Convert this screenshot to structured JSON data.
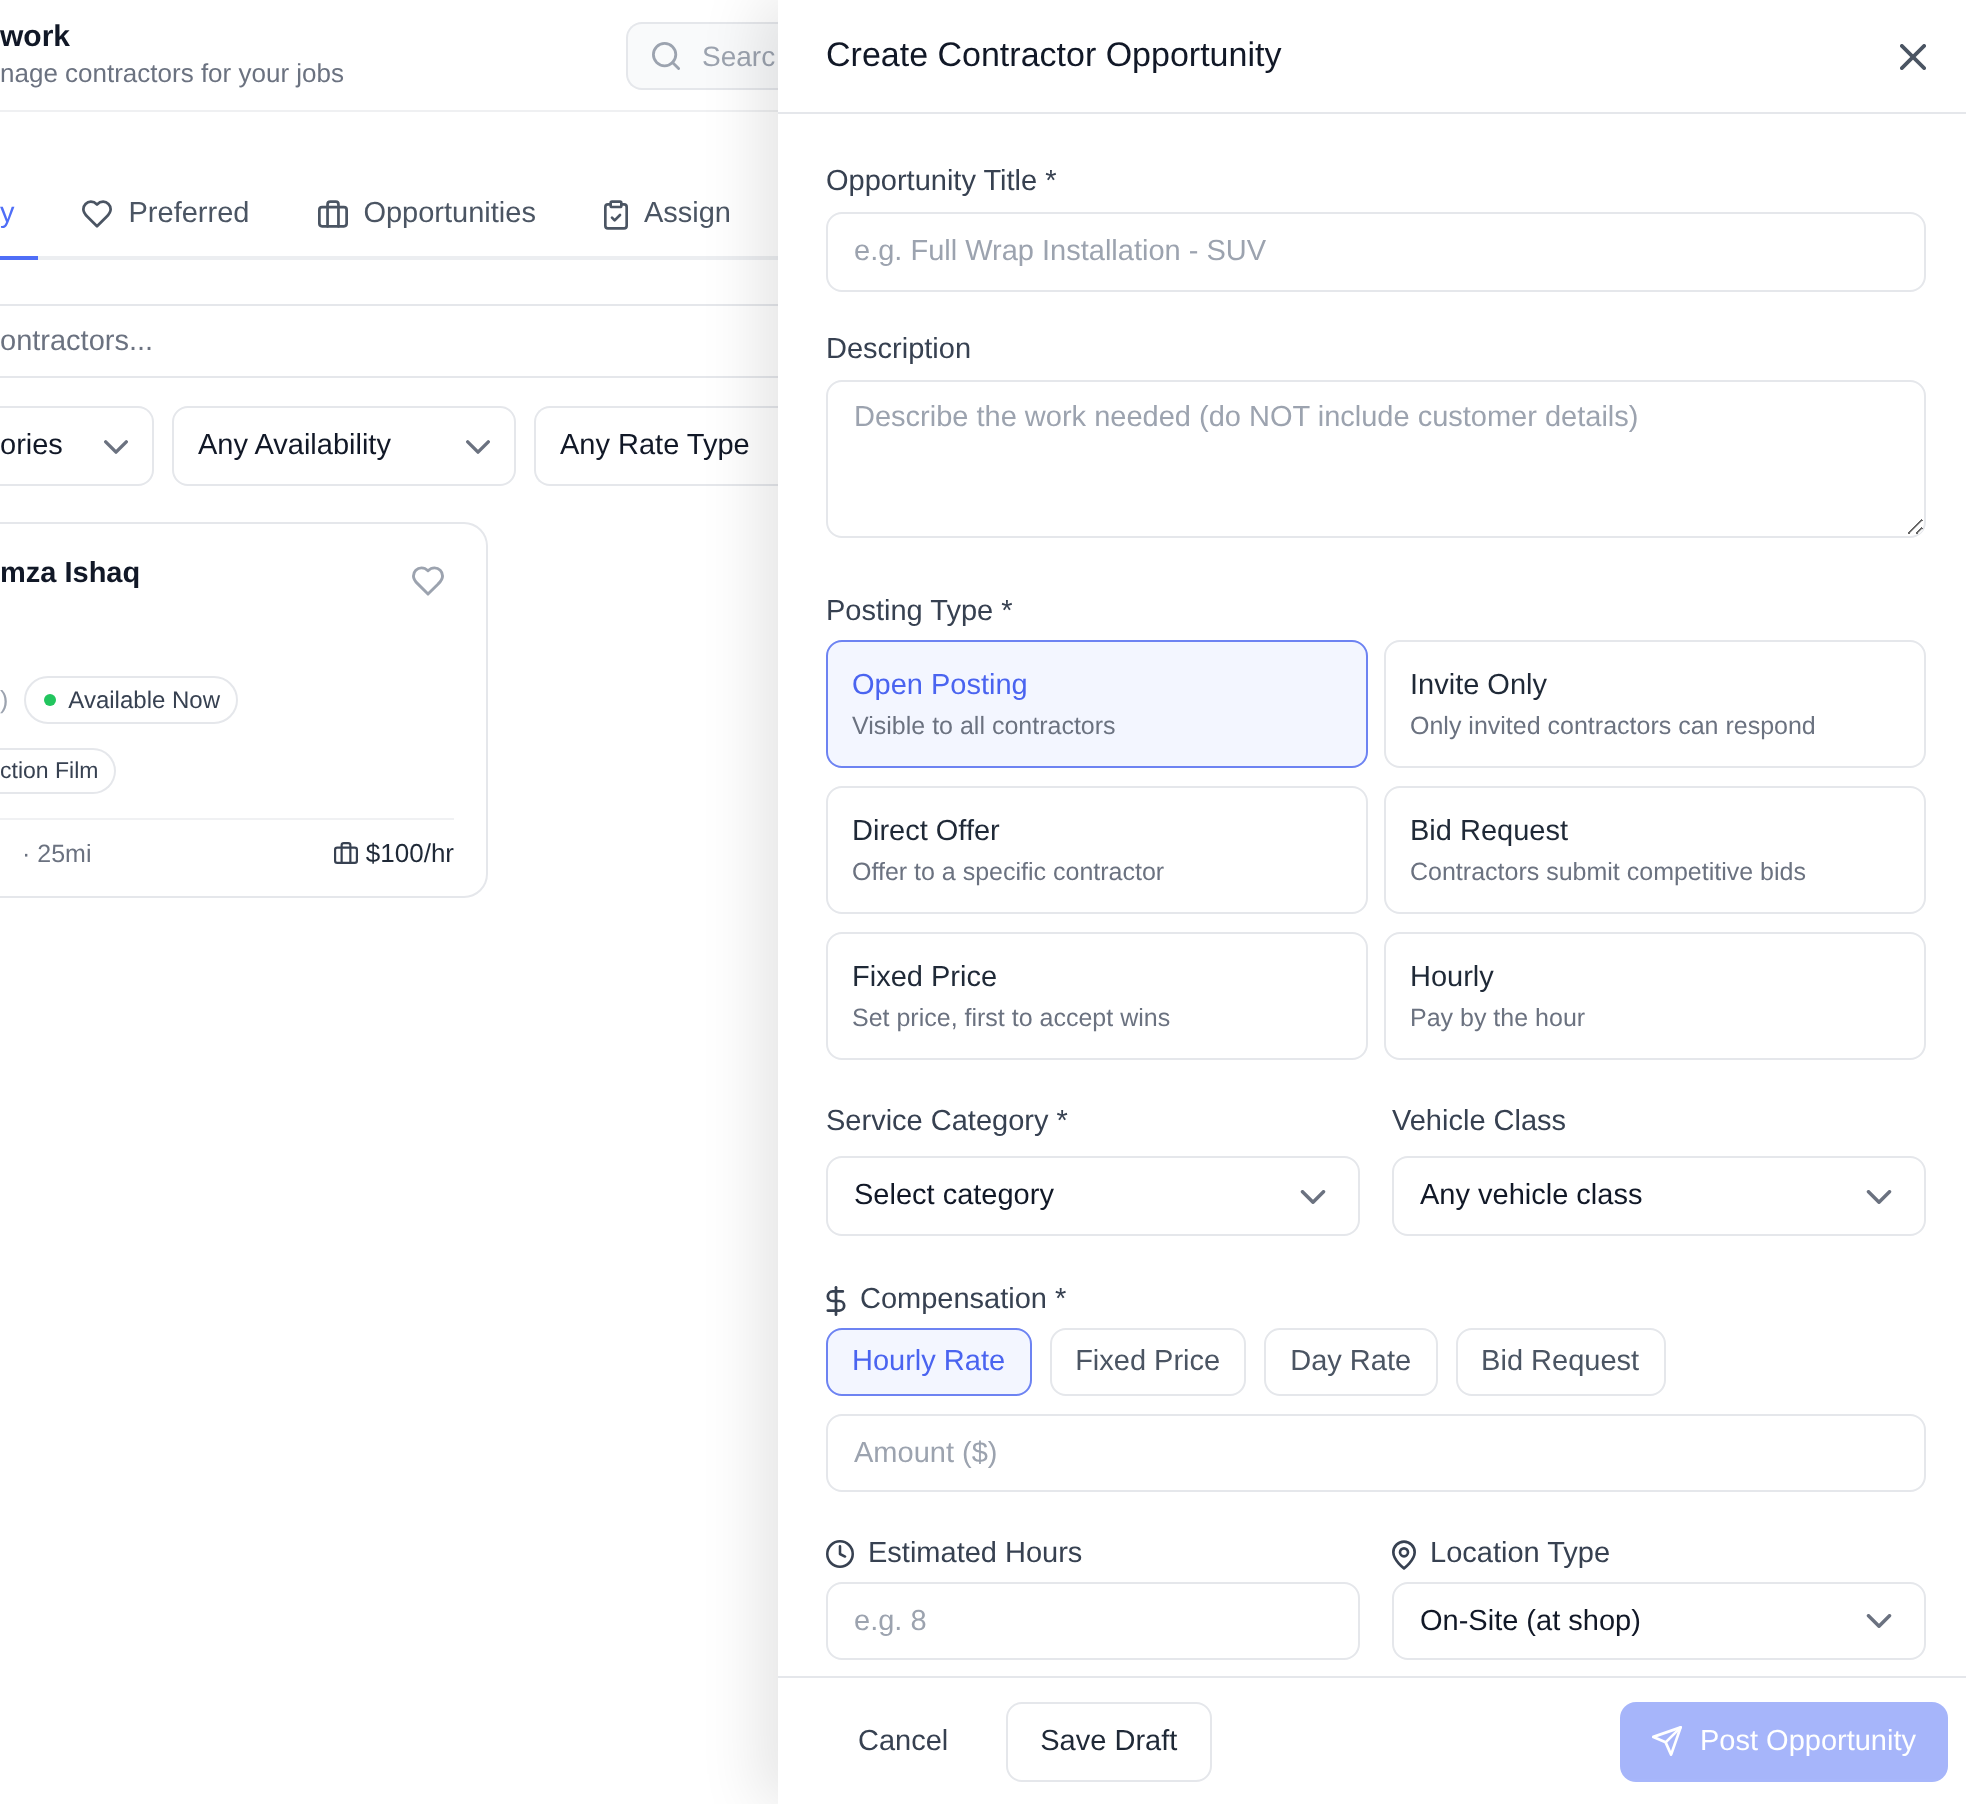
{
  "background_page": {
    "header": {
      "title": "work",
      "subtitle": "nage contractors for your jobs",
      "search": {
        "placeholder": "Searc"
      }
    },
    "tabs": [
      {
        "label": "y",
        "selected": true
      },
      {
        "label": "Preferred",
        "selected": false
      },
      {
        "label": "Opportunities",
        "selected": false
      },
      {
        "label": "Assign",
        "selected": false
      }
    ],
    "contractor_search": {
      "placeholder": "ontractors..."
    },
    "filters": [
      {
        "value": "ories"
      },
      {
        "value": "Any Availability"
      },
      {
        "value": "Any Rate Type"
      }
    ],
    "contractor_card": {
      "name": "mza Ishaq",
      "favorite": false,
      "text_fragment": ")",
      "availability": "Available Now",
      "tags": [
        "ction Film"
      ],
      "distance": "· 25mi",
      "rate": "$100/hr"
    }
  },
  "modal": {
    "title": "Create Contractor Opportunity",
    "opportunity_title": {
      "label": "Opportunity Title *",
      "placeholder": "e.g. Full Wrap Installation - SUV"
    },
    "description": {
      "label": "Description",
      "placeholder": "Describe the work needed (do NOT include customer details)"
    },
    "posting_type": {
      "label": "Posting Type *",
      "options": [
        {
          "title": "Open Posting",
          "description": "Visible to all contractors",
          "selected": true
        },
        {
          "title": "Invite Only",
          "description": "Only invited contractors can respond",
          "selected": false
        },
        {
          "title": "Direct Offer",
          "description": "Offer to a specific contractor",
          "selected": false
        },
        {
          "title": "Bid Request",
          "description": "Contractors submit competitive bids",
          "selected": false
        },
        {
          "title": "Fixed Price",
          "description": "Set price, first to accept wins",
          "selected": false
        },
        {
          "title": "Hourly",
          "description": "Pay by the hour",
          "selected": false
        }
      ]
    },
    "service_category": {
      "label": "Service Category *",
      "value": "Select category"
    },
    "vehicle_class": {
      "label": "Vehicle Class",
      "value": "Any vehicle class"
    },
    "compensation": {
      "label": "Compensation *",
      "options": [
        {
          "label": "Hourly Rate",
          "selected": true
        },
        {
          "label": "Fixed Price",
          "selected": false
        },
        {
          "label": "Day Rate",
          "selected": false
        },
        {
          "label": "Bid Request",
          "selected": false
        }
      ],
      "amount": {
        "placeholder": "Amount ($)"
      }
    },
    "estimated_hours": {
      "label": "Estimated Hours",
      "placeholder": "e.g. 8"
    },
    "location_type": {
      "label": "Location Type",
      "value": "On-Site (at shop)"
    },
    "footer": {
      "cancel": "Cancel",
      "save_draft": "Save Draft",
      "post": {
        "label": "Post Opportunity",
        "disabled": true
      }
    }
  }
}
